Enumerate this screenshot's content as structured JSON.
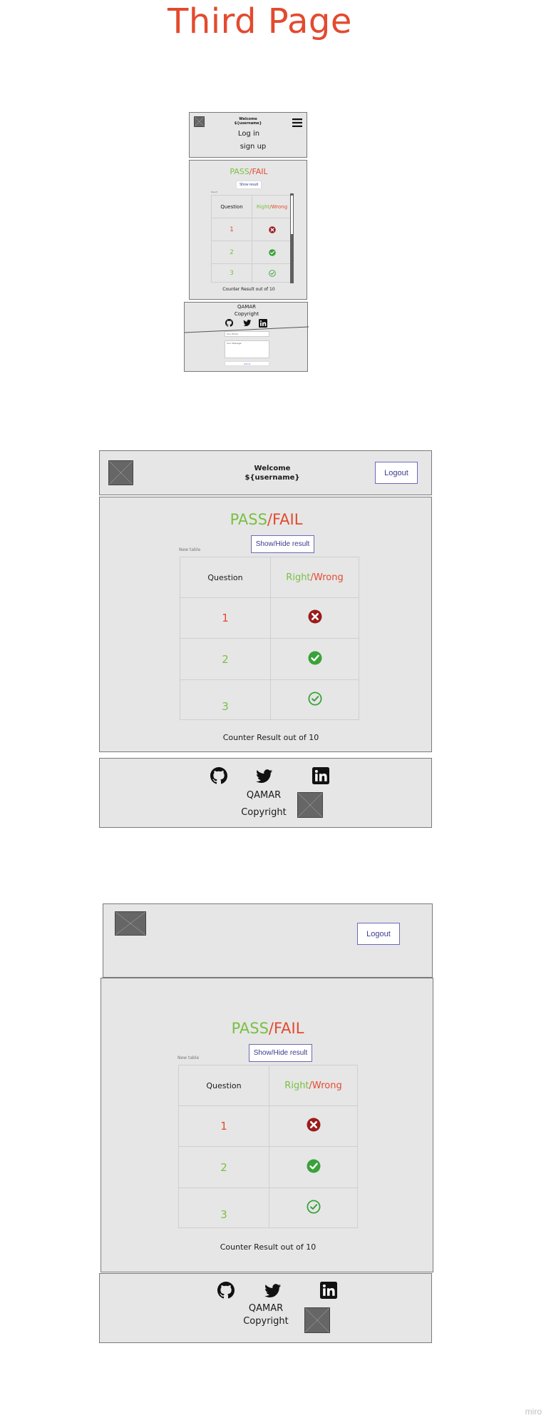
{
  "page": {
    "title": "Third Page",
    "watermark": "miro"
  },
  "common": {
    "welcome": "Welcome",
    "username": "${username}",
    "logout": "Logout",
    "login": "Log in",
    "signup": "sign up",
    "pass": "PASS",
    "slash": "/",
    "fail": "FAIL",
    "show_result_small": "Show result",
    "show_hide_result": "Show/Hide result",
    "table_label_small": "Result",
    "table_label": "New table",
    "col_question": "Question",
    "col_right": "Right",
    "col_wrong": "Wrong",
    "counter": "Counter Result out of 10",
    "brand": "QAMAR",
    "copyright": "Copyright",
    "email_placeholder": "Your Email",
    "message_placeholder": "Your Message",
    "submit": "Submit"
  },
  "rows": [
    {
      "q": "1",
      "status": "wrong"
    },
    {
      "q": "2",
      "status": "right"
    },
    {
      "q": "3",
      "status": "right-outline"
    }
  ],
  "colors": {
    "green": "#79c043",
    "red": "#e34a2f",
    "dark_red": "#9b1c1c",
    "check_green": "#3aa23a"
  }
}
